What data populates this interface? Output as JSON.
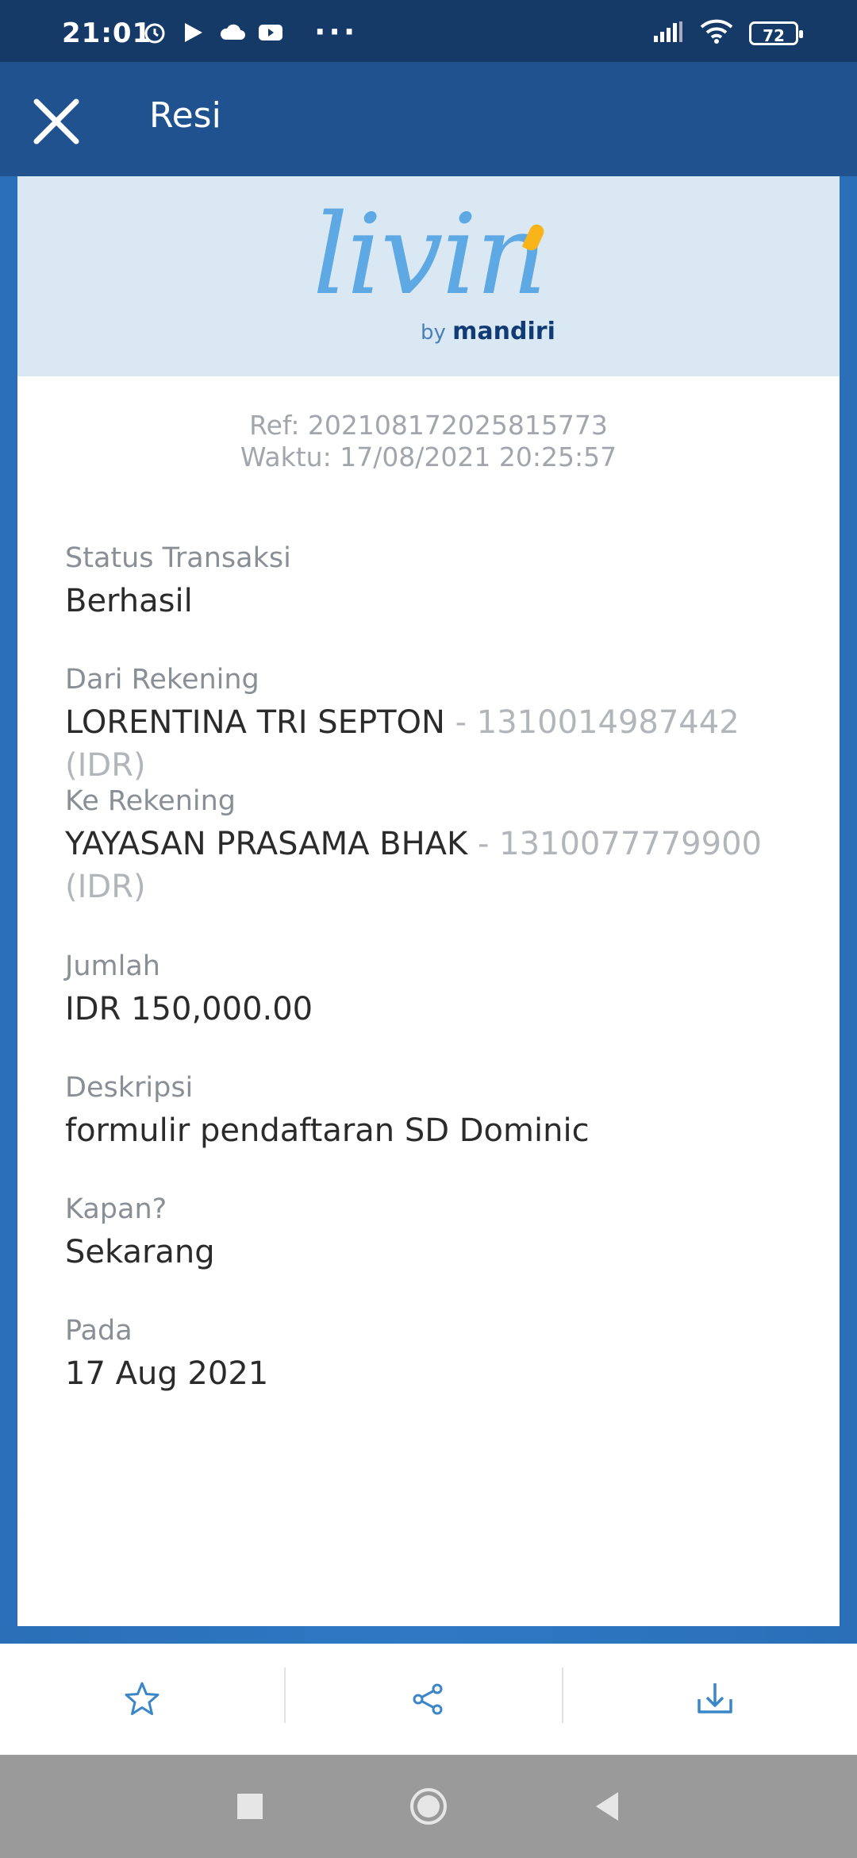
{
  "status_bar": {
    "time": "21:01",
    "battery": "72",
    "icons": [
      "alarm-icon",
      "play-store-icon",
      "cloud-icon",
      "youtube-icon",
      "more-icon",
      "signal-icon",
      "wifi-icon",
      "battery-icon"
    ]
  },
  "app_bar": {
    "title": "Resi",
    "close_icon": "close-icon"
  },
  "logo": {
    "main": "livin",
    "by": "by",
    "brand": "mandiri"
  },
  "receipt": {
    "ref": "Ref: 202108172025815773",
    "waktu": "Waktu: 17/08/2021 20:25:57",
    "fields": [
      {
        "label": "Status Transaksi",
        "value": "Berhasil"
      },
      {
        "label": "Dari Rekening",
        "value": "LORENTINA TRI SEPTON",
        "extra": " - 1310014987442 (IDR)"
      },
      {
        "label": "Ke Rekening",
        "value": "YAYASAN PRASAMA BHAK",
        "extra": " - 1310077779900 (IDR)"
      },
      {
        "label": "Jumlah",
        "value": "IDR 150,000.00"
      },
      {
        "label": "Deskripsi",
        "value": "formulir pendaftaran SD Dominic"
      },
      {
        "label": "Kapan?",
        "value": "Sekarang"
      },
      {
        "label": "Pada",
        "value": "17 Aug 2021"
      }
    ]
  },
  "bottom_actions": [
    {
      "icon": "star-icon"
    },
    {
      "icon": "share-icon"
    },
    {
      "icon": "download-icon"
    }
  ],
  "nav": [
    "recents-square-icon",
    "home-circle-icon",
    "back-triangle-icon"
  ],
  "colors": {
    "status_bar": "#163a67",
    "app_bar": "#1f528f",
    "frame": "#2f78c4",
    "logo_band": "#dae8f4",
    "accent_icon": "#3a86c8",
    "logo_blue": "#5ea9e4",
    "logo_yellow": "#f8b418"
  }
}
